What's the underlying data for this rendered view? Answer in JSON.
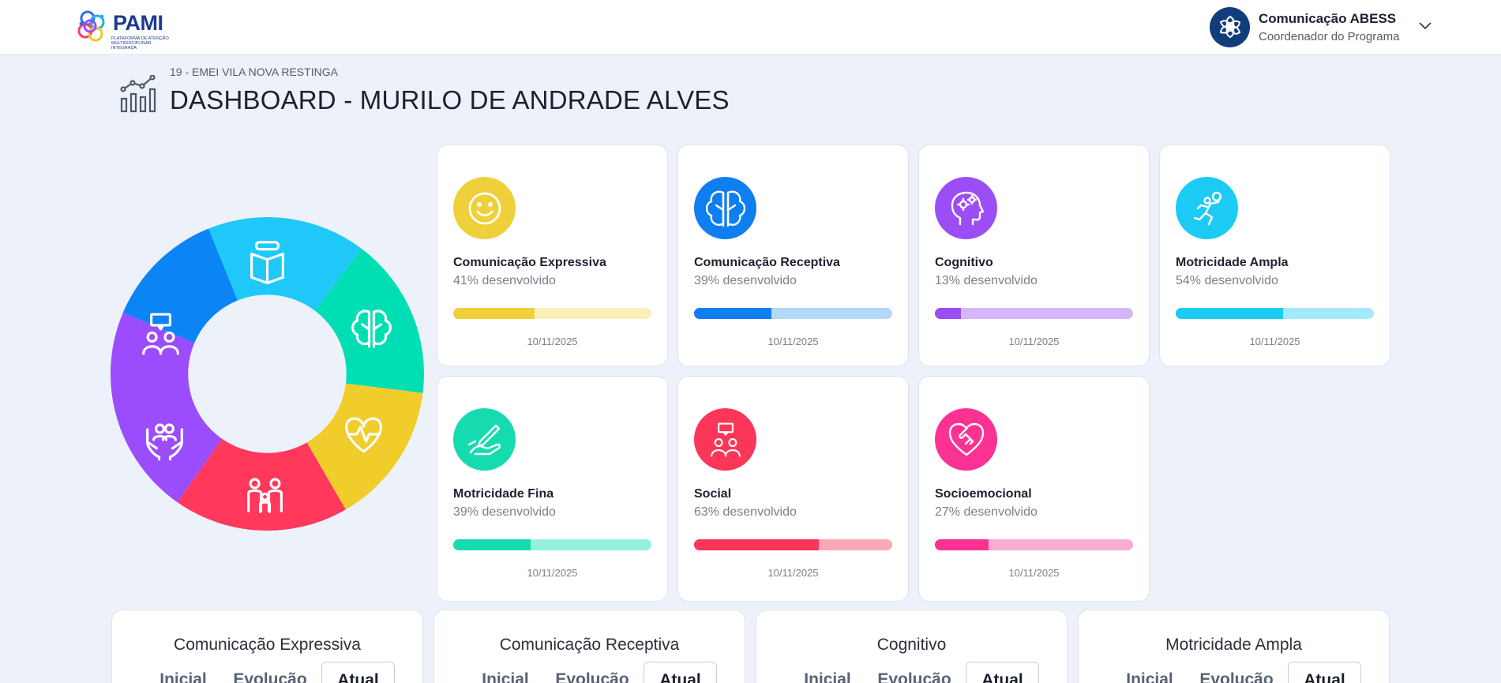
{
  "brand": {
    "name": "PAMI",
    "tagline": "PLATAFORMA DE ATENÇÃO MULTIDISCIPLINAR INTEGRADA"
  },
  "user": {
    "name": "Comunicação ABESS",
    "role": "Coordenador do Programa"
  },
  "header": {
    "breadcrumb": "19 - EMEI VILA NOVA RESTINGA",
    "title": "DASHBOARD - MURILO DE ANDRADE ALVES"
  },
  "donut": {
    "segments": [
      {
        "icon": "book-icon",
        "color": "#0b84f5"
      },
      {
        "icon": "brain-icon",
        "color": "#1fc8f8"
      },
      {
        "icon": "heartbeat-icon",
        "color": "#00dfb3"
      },
      {
        "icon": "family-icon",
        "color": "#f0cd2b"
      },
      {
        "icon": "hands-care-icon",
        "color": "#ff385c"
      },
      {
        "icon": "people-chat-icon",
        "color": "#9b4dfd"
      }
    ]
  },
  "cards": [
    {
      "title": "Comunicação Expressiva",
      "pct_text": "41% desenvolvido",
      "pct": 41,
      "date": "10/11/2025",
      "color": "#f0d03a",
      "track": "#fbf0bc",
      "icon": "smiley-icon"
    },
    {
      "title": "Comunicação Receptiva",
      "pct_text": "39% desenvolvido",
      "pct": 39,
      "date": "10/11/2025",
      "color": "#0f7ff0",
      "track": "#b4d8f8",
      "icon": "brain-icon"
    },
    {
      "title": "Cognitivo",
      "pct_text": "13% desenvolvido",
      "pct": 13,
      "date": "10/11/2025",
      "color": "#9b4ef6",
      "track": "#d6b6fb",
      "icon": "head-gears-icon"
    },
    {
      "title": "Motricidade Ampla",
      "pct_text": "54% desenvolvido",
      "pct": 54,
      "date": "10/11/2025",
      "color": "#1ccbf3",
      "track": "#a4e9fb",
      "icon": "athlete-icon"
    },
    {
      "title": "Motricidade Fina",
      "pct_text": "39% desenvolvido",
      "pct": 39,
      "date": "10/11/2025",
      "color": "#16dbb1",
      "track": "#95f1dd",
      "icon": "hand-writing-icon"
    },
    {
      "title": "Social",
      "pct_text": "63% desenvolvido",
      "pct": 63,
      "date": "10/11/2025",
      "color": "#fb3659",
      "track": "#fba9b9",
      "icon": "people-chat-icon"
    },
    {
      "title": "Socioemocional",
      "pct_text": "27% desenvolvido",
      "pct": 27,
      "date": "10/11/2025",
      "color": "#fb3291",
      "track": "#fbadd1",
      "icon": "heart-handshake-icon"
    }
  ],
  "panels": [
    {
      "title": "Comunicação Expressiva",
      "tabs": [
        "Inicial",
        "Evolução",
        "Atual"
      ]
    },
    {
      "title": "Comunicação Receptiva",
      "tabs": [
        "Inicial",
        "Evolução",
        "Atual"
      ]
    },
    {
      "title": "Cognitivo",
      "tabs": [
        "Inicial",
        "Evolução",
        "Atual"
      ]
    },
    {
      "title": "Motricidade Ampla",
      "tabs": [
        "Inicial",
        "Evolução",
        "Atual"
      ]
    }
  ]
}
